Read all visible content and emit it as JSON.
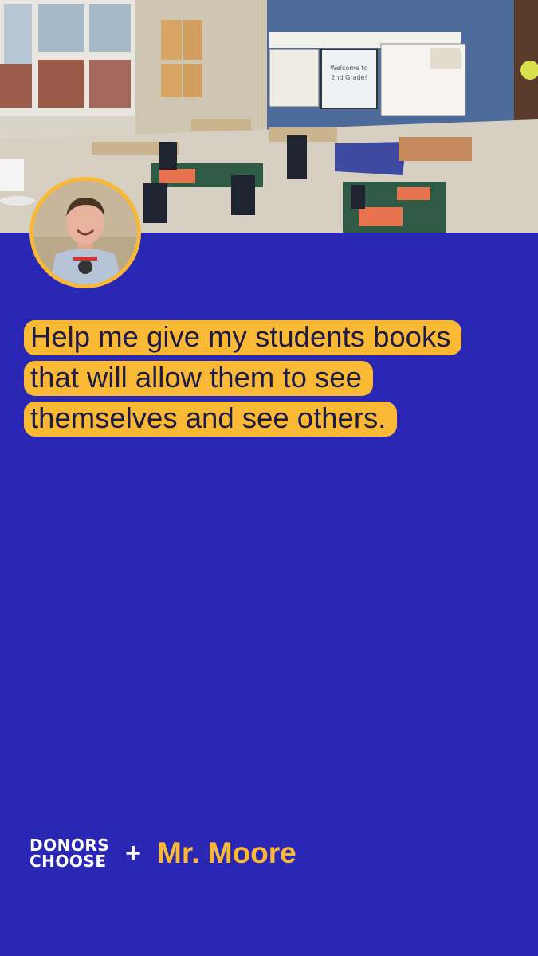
{
  "hero": {
    "board_text_line1": "Welcome to",
    "board_text_line2": "2nd Grade!"
  },
  "headline": {
    "lines": [
      "Help me give my students books",
      "that will allow them to see",
      "themselves and see others."
    ]
  },
  "footer": {
    "logo_line1": "DONORS",
    "logo_line2": "CHOOSE",
    "plus": "+",
    "teacher_name": "Mr. Moore"
  },
  "colors": {
    "background": "#2a27b4",
    "accent": "#f9b934",
    "text_dark": "#1d1a48"
  }
}
